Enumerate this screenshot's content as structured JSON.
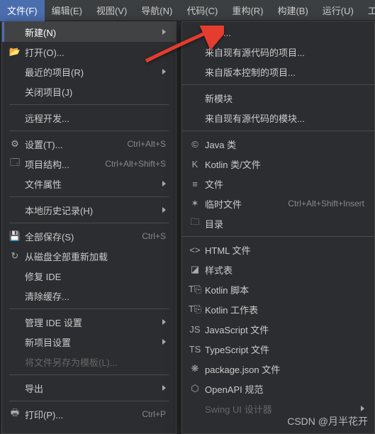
{
  "menubar": {
    "items": [
      {
        "label": "文件(F)",
        "active": true
      },
      {
        "label": "编辑(E)"
      },
      {
        "label": "视图(V)"
      },
      {
        "label": "导航(N)"
      },
      {
        "label": "代码(C)"
      },
      {
        "label": "重构(R)"
      },
      {
        "label": "构建(B)"
      },
      {
        "label": "运行(U)"
      },
      {
        "label": "工具("
      }
    ]
  },
  "left": {
    "items": [
      {
        "icon": "",
        "label": "新建(N)",
        "hl": true,
        "sub": true
      },
      {
        "icon": "📂",
        "label": "打开(O)..."
      },
      {
        "icon": "",
        "label": "最近的项目(R)",
        "sub": true
      },
      {
        "icon": "",
        "label": "关闭项目(J)"
      },
      {
        "sep": true
      },
      {
        "icon": "",
        "label": "远程开发..."
      },
      {
        "sep": true
      },
      {
        "icon": "⚙",
        "label": "设置(T)...",
        "sc": "Ctrl+Alt+S"
      },
      {
        "icon": "🗔",
        "label": "项目结构...",
        "sc": "Ctrl+Alt+Shift+S"
      },
      {
        "icon": "",
        "label": "文件属性",
        "sub": true
      },
      {
        "sep": true
      },
      {
        "icon": "",
        "label": "本地历史记录(H)",
        "sub": true
      },
      {
        "sep": true
      },
      {
        "icon": "💾",
        "label": "全部保存(S)",
        "sc": "Ctrl+S"
      },
      {
        "icon": "↻",
        "label": "从磁盘全部重新加载"
      },
      {
        "icon": "",
        "label": "修复 IDE"
      },
      {
        "icon": "",
        "label": "清除缓存..."
      },
      {
        "sep": true
      },
      {
        "icon": "",
        "label": "管理 IDE 设置",
        "sub": true
      },
      {
        "icon": "",
        "label": "新项目设置",
        "sub": true
      },
      {
        "icon": "",
        "label": "将文件另存为模板(L)...",
        "dim": true
      },
      {
        "sep": true
      },
      {
        "icon": "",
        "label": "导出",
        "sub": true
      },
      {
        "sep": true
      },
      {
        "icon": "🖶",
        "label": "打印(P)...",
        "sc": "Ctrl+P"
      }
    ]
  },
  "right": {
    "items": [
      {
        "icon": "",
        "label": "项目..."
      },
      {
        "icon": "",
        "label": "来自现有源代码的项目..."
      },
      {
        "icon": "",
        "label": "来自版本控制的项目..."
      },
      {
        "sep": true
      },
      {
        "icon": "",
        "label": "新模块"
      },
      {
        "icon": "",
        "label": "来自现有源代码的模块..."
      },
      {
        "sep": true
      },
      {
        "icon": "©",
        "ic": "java",
        "label": "Java 类"
      },
      {
        "icon": "K",
        "ic": "kotlin",
        "label": "Kotlin 类/文件"
      },
      {
        "icon": "≡",
        "label": "文件"
      },
      {
        "icon": "✶",
        "label": "临时文件",
        "sc": "Ctrl+Alt+Shift+Insert"
      },
      {
        "icon": "🗀",
        "ic": "dirFolder",
        "label": "目录"
      },
      {
        "sep": true
      },
      {
        "icon": "<>",
        "ic": "html",
        "label": "HTML 文件"
      },
      {
        "icon": "◪",
        "ic": "css",
        "label": "样式表"
      },
      {
        "icon": "T⎘",
        "label": "Kotlin 脚本"
      },
      {
        "icon": "T⎘",
        "label": "Kotlin 工作表"
      },
      {
        "icon": "JS",
        "ic": "js",
        "label": "JavaScript 文件"
      },
      {
        "icon": "TS",
        "ic": "ts",
        "label": "TypeScript 文件"
      },
      {
        "icon": "❋",
        "ic": "json",
        "label": "package.json 文件"
      },
      {
        "icon": "⬡",
        "ic": "openapi",
        "label": "OpenAPI 规范"
      },
      {
        "icon": "",
        "label": "Swing UI 设计器",
        "sub": true,
        "dim": true
      }
    ]
  },
  "watermark": "CSDN @月半花开"
}
